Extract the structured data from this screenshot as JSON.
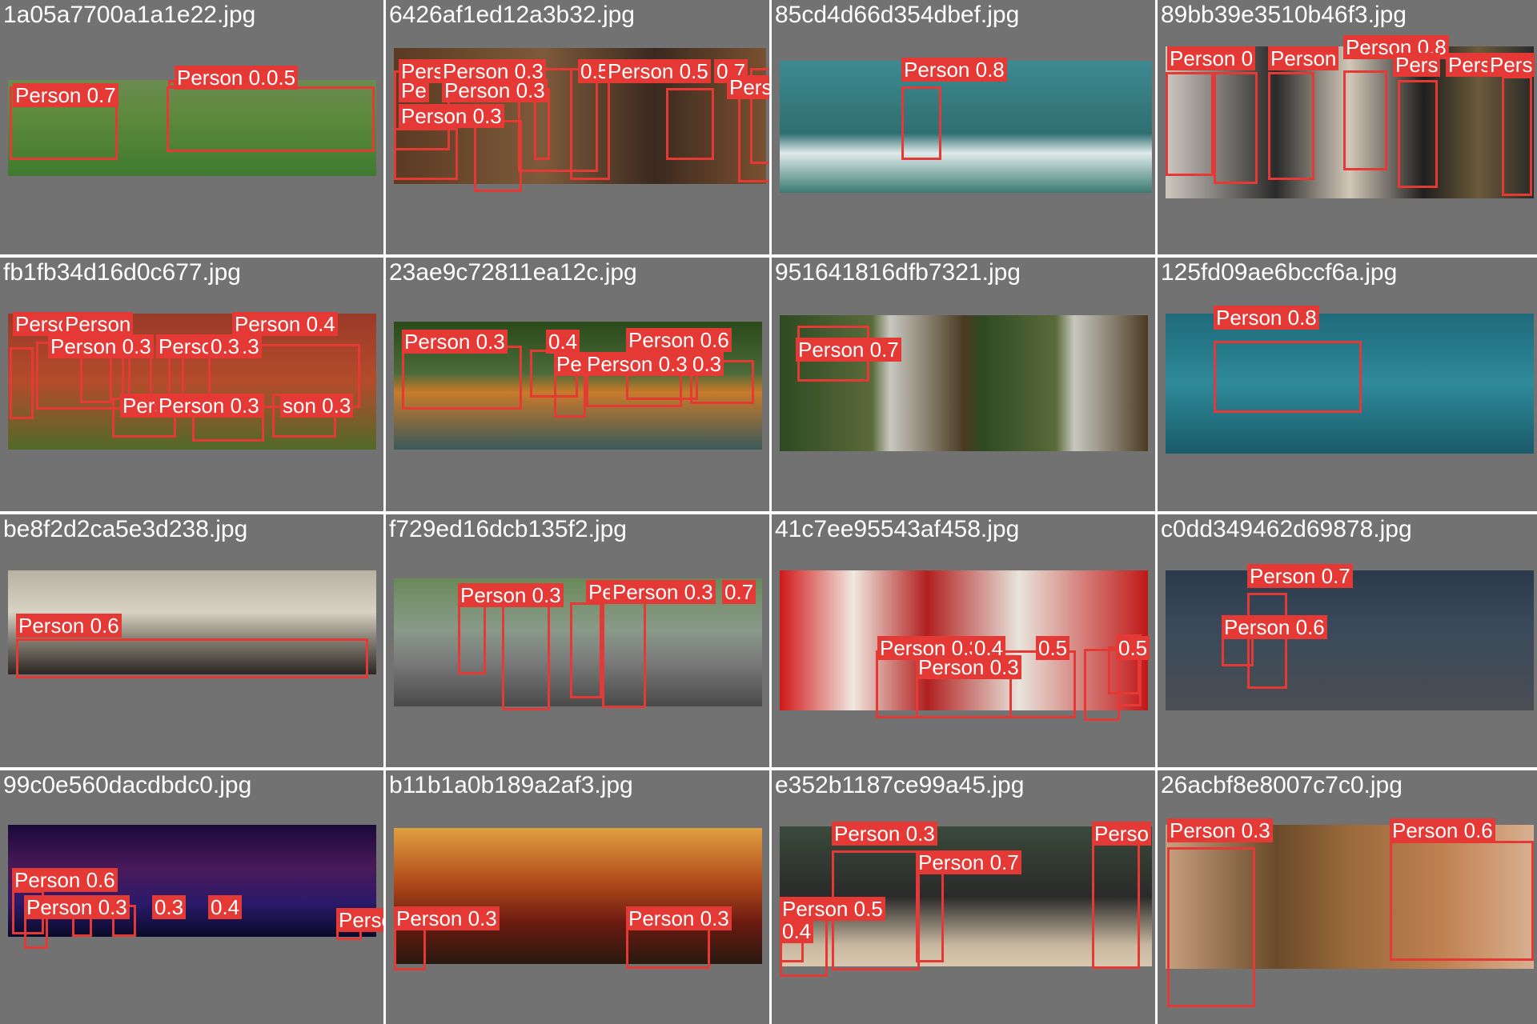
{
  "colors": {
    "box": "#e53935",
    "cell_bg": "#727272",
    "grid_bg": "#ffffff",
    "text": "#ffffff"
  },
  "cells": [
    {
      "file": "1a05a7700a1a1e22.jpg",
      "labels": [
        "Person 0.7",
        "Person 0.5",
        "0.5"
      ]
    },
    {
      "file": "6426af1ed12a3b32.jpg",
      "labels": [
        "Pers",
        "Person 0.3",
        "0.5",
        "Person 0.5",
        "0.7",
        "Person 0.5",
        "Pe",
        "Person 0.3",
        "Person 0.3"
      ]
    },
    {
      "file": "85cd4d66d354dbef.jpg",
      "labels": [
        "Person 0.8"
      ]
    },
    {
      "file": "89bb39e3510b46f3.jpg",
      "labels": [
        "Person 0",
        "Person",
        "Person 0.8",
        "Pers",
        "Pers",
        "Pers"
      ]
    },
    {
      "file": "fb1fb34d16d0c677.jpg",
      "labels": [
        "Person 0.4",
        "Person 0.3",
        "Person",
        "Person 0.3",
        "0.3",
        "Person 0.4",
        "Pers",
        "Person 0.3",
        "son 0.3"
      ]
    },
    {
      "file": "23ae9c72811ea12c.jpg",
      "labels": [
        "Person 0.3",
        "0.4",
        "Person 0.6",
        "Pe",
        "Person 0.3",
        "0.3"
      ]
    },
    {
      "file": "951641816dfb7321.jpg",
      "labels": [
        "Person 0.7"
      ]
    },
    {
      "file": "125fd09ae6bccf6a.jpg",
      "labels": [
        "Person 0.8"
      ]
    },
    {
      "file": "be8f2d2ca5e3d238.jpg",
      "labels": [
        "Person 0.6"
      ]
    },
    {
      "file": "f729ed16dcb135f2.jpg",
      "labels": [
        "Person 0.3",
        "Pe",
        "Person 0.3",
        "0.7"
      ]
    },
    {
      "file": "41c7ee95543af458.jpg",
      "labels": [
        "Person 0.3",
        "0.4",
        "0.5",
        "Person 0.3",
        "0.5"
      ]
    },
    {
      "file": "c0dd349462d69878.jpg",
      "labels": [
        "Person 0.7",
        "Person 0.6"
      ]
    },
    {
      "file": "99c0e560dacdbdc0.jpg",
      "labels": [
        "Person 0.6",
        "Person 0.3",
        "0.3",
        "0.4",
        "Perso"
      ]
    },
    {
      "file": "b11b1a0b189a2af3.jpg",
      "labels": [
        "Person 0.3",
        "Person 0.3"
      ]
    },
    {
      "file": "e352b1187ce99a45.jpg",
      "labels": [
        "Person 0.3",
        "Person 0.7",
        "Person 0.5",
        "0.4",
        "Perso"
      ]
    },
    {
      "file": "26acbf8e8007c7c0.jpg",
      "labels": [
        "Person 0.3",
        "Person 0.6"
      ]
    }
  ]
}
